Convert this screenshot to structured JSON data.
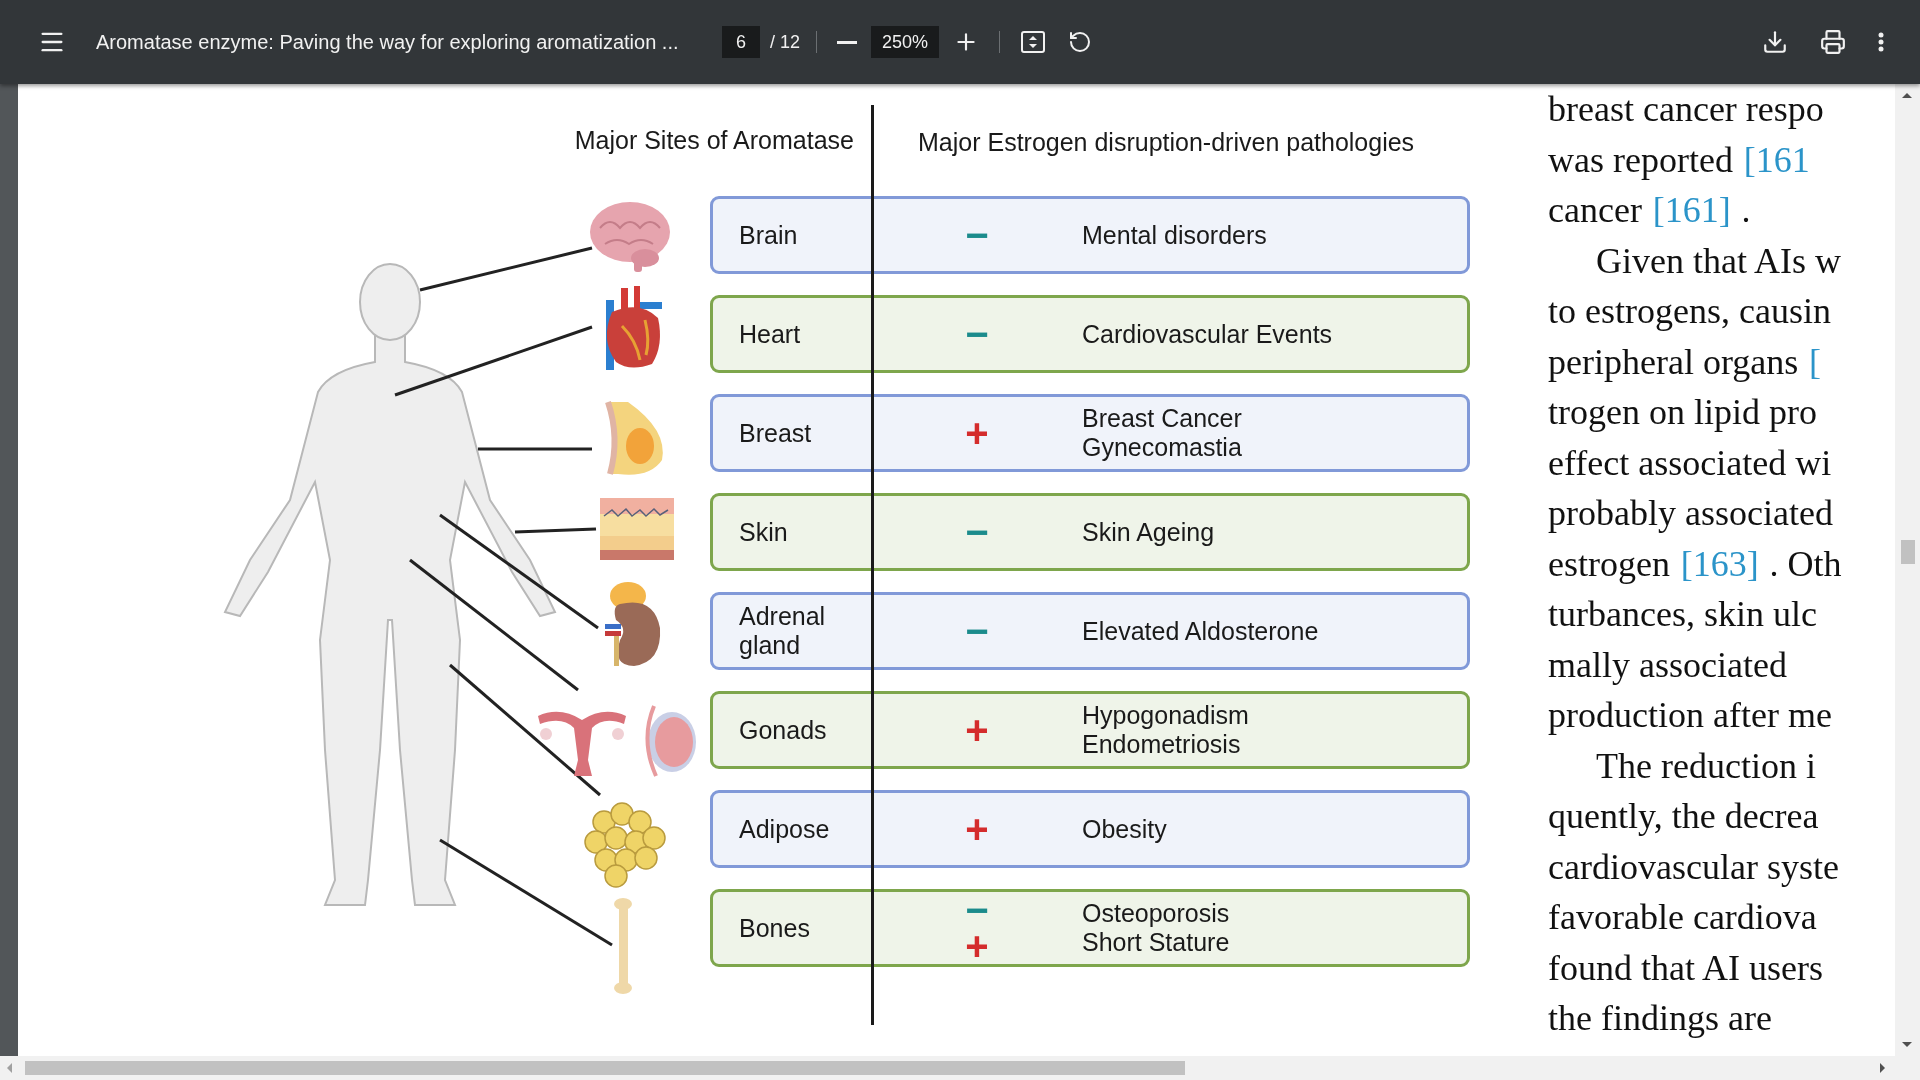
{
  "toolbar": {
    "title": "Aromatase enzyme: Paving the way for exploring aromatization ...",
    "page": "6",
    "page_count": "/ 12",
    "zoom": "250%"
  },
  "figure": {
    "sites_heading": "Major Sites of Aromatase",
    "pathologies_heading": "Major Estrogen disruption-driven pathologies",
    "rows": [
      {
        "site": "Brain",
        "color": "#8199d8",
        "effects": [
          {
            "kind": "decrease",
            "symbol": "−"
          }
        ],
        "pathologies": [
          "Mental disorders"
        ]
      },
      {
        "site": "Heart",
        "color": "#7ea64c",
        "effects": [
          {
            "kind": "decrease",
            "symbol": "−"
          }
        ],
        "pathologies": [
          "Cardiovascular Events"
        ]
      },
      {
        "site": "Breast",
        "color": "#8199d8",
        "effects": [
          {
            "kind": "increase",
            "symbol": "+"
          }
        ],
        "pathologies": [
          "Breast Cancer",
          "Gynecomastia"
        ]
      },
      {
        "site": "Skin",
        "color": "#7ea64c",
        "effects": [
          {
            "kind": "decrease",
            "symbol": "−"
          }
        ],
        "pathologies": [
          "Skin Ageing"
        ]
      },
      {
        "site": "Adrenal gland",
        "color": "#8199d8",
        "effects": [
          {
            "kind": "decrease",
            "symbol": "−"
          }
        ],
        "pathologies": [
          "Elevated Aldosterone"
        ]
      },
      {
        "site": "Gonads",
        "color": "#7ea64c",
        "effects": [
          {
            "kind": "increase",
            "symbol": "+"
          }
        ],
        "pathologies": [
          "Hypogonadism",
          "Endometriosis"
        ]
      },
      {
        "site": "Adipose",
        "color": "#8199d8",
        "effects": [
          {
            "kind": "increase",
            "symbol": "+"
          }
        ],
        "pathologies": [
          "Obesity"
        ]
      },
      {
        "site": "Bones",
        "color": "#7ea64c",
        "effects": [
          {
            "kind": "decrease",
            "symbol": "−"
          },
          {
            "kind": "increase",
            "symbol": "+"
          }
        ],
        "pathologies": [
          "Osteoporosis",
          "Short Stature"
        ]
      }
    ]
  },
  "text_lines": [
    {
      "indent": false,
      "parts": [
        {
          "text": "breast cancer respo"
        }
      ]
    },
    {
      "indent": false,
      "parts": [
        {
          "text": "was reported"
        },
        {
          "text": "[161",
          "kind": "citation"
        }
      ]
    },
    {
      "indent": false,
      "parts": [
        {
          "text": "cancer"
        },
        {
          "text": "[161]",
          "kind": "citation"
        },
        {
          "text": "."
        }
      ]
    },
    {
      "indent": true,
      "parts": [
        {
          "text": "Given that AIs w"
        }
      ]
    },
    {
      "indent": false,
      "parts": [
        {
          "text": "to estrogens, causin"
        }
      ]
    },
    {
      "indent": false,
      "parts": [
        {
          "text": "peripheral organs"
        },
        {
          "text": "[",
          "kind": "citation"
        }
      ]
    },
    {
      "indent": false,
      "parts": [
        {
          "text": "trogen on lipid pro"
        }
      ]
    },
    {
      "indent": false,
      "parts": [
        {
          "text": "effect associated wi"
        }
      ]
    },
    {
      "indent": false,
      "parts": [
        {
          "text": "probably associated"
        }
      ]
    },
    {
      "indent": false,
      "parts": [
        {
          "text": "estrogen"
        },
        {
          "text": "[163]",
          "kind": "citation"
        },
        {
          "text": ". Oth"
        }
      ]
    },
    {
      "indent": false,
      "parts": [
        {
          "text": "turbances, skin ulc"
        }
      ]
    },
    {
      "indent": false,
      "parts": [
        {
          "text": "mally associated"
        }
      ]
    },
    {
      "indent": false,
      "parts": [
        {
          "text": "production after me"
        }
      ]
    },
    {
      "indent": true,
      "parts": [
        {
          "text": "The reduction i"
        }
      ]
    },
    {
      "indent": false,
      "parts": [
        {
          "text": "quently, the decrea"
        }
      ]
    },
    {
      "indent": false,
      "parts": [
        {
          "text": "cardiovascular syste"
        }
      ]
    },
    {
      "indent": false,
      "parts": [
        {
          "text": "favorable cardiova"
        }
      ]
    },
    {
      "indent": false,
      "parts": [
        {
          "text": "found that AI users"
        }
      ]
    },
    {
      "indent": false,
      "parts": [
        {
          "text": "the findings are"
        }
      ]
    }
  ]
}
